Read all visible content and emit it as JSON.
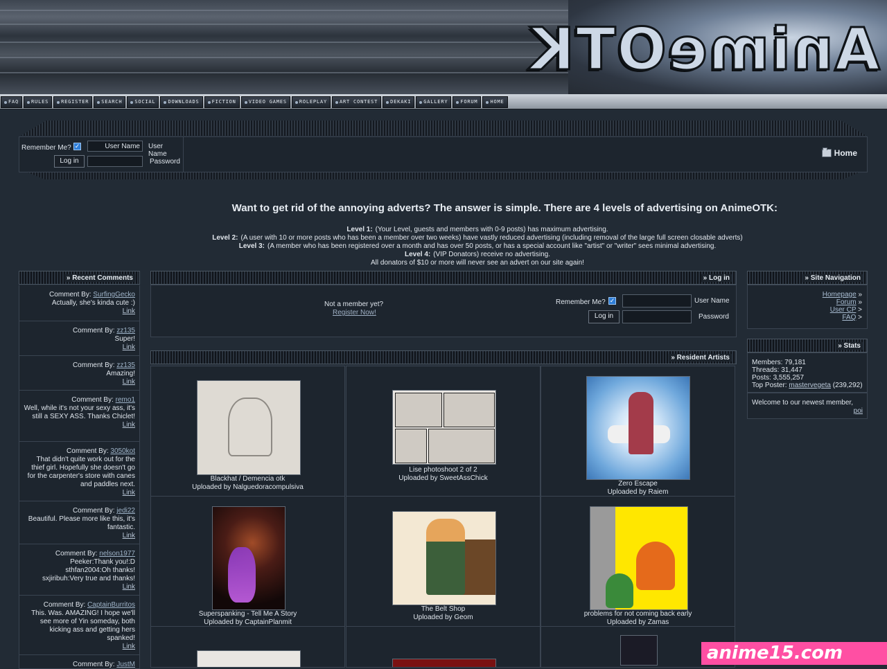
{
  "banner": {
    "logo_text": "AnimeOTK"
  },
  "nav": {
    "buttons": [
      "HOME",
      "FORUM",
      "GALLERY",
      "DEKAKI",
      "ART CONTEST",
      "ROLEPLAY",
      "VIDEO GAMES",
      "FICTION",
      "DOWNLOADS",
      "SOCIAL",
      "SEARCH",
      "REGISTER",
      "RULES",
      "FAQ"
    ]
  },
  "header": {
    "home_label": "Home",
    "login": {
      "username_label": "User Name",
      "username_value": "User Name",
      "password_label": "Password",
      "remember_label": "Remember Me?",
      "login_button": "Log in"
    }
  },
  "announcement": {
    "title": "Want to get rid of the annoying adverts? The answer is simple. There are 4 levels of advertising on AnimeOTK:",
    "levels": [
      {
        "label": "Level 1:",
        "text": "(Your Level, guests and members with 0-9 posts) has maximum advertising."
      },
      {
        "label": "Level 2:",
        "text": "(A user with 10 or more posts who has been a member over two weeks) have vastly reduced advertising (including removal of the large full screen closable adverts)"
      },
      {
        "label": "Level 3:",
        "text": "(A member who has been registered over a month and has over 50 posts, or has a special account like \"artist\" or \"writer\" sees minimal advertising."
      },
      {
        "label": "Level 4:",
        "text": "(VIP Donators) receive no advertising."
      }
    ],
    "footer": "All donators of $10 or more will never see an advert on our site again!"
  },
  "recent_comments": {
    "title": "» Recent Comments",
    "by_label": "Comment By:",
    "link_label": "Link",
    "items": [
      {
        "user": "SurfingGecko",
        "text": "Actually, she's kinda cute :)"
      },
      {
        "user": "zz135",
        "text": "Super!"
      },
      {
        "user": "zz135",
        "text": "Amazing!"
      },
      {
        "user": "remo1",
        "text": "Well, while it's not your sexy ass, it's still a SEXY ASS. Thanks Chiclet!"
      },
      {
        "user": "3050kot",
        "text": "That didn't quite work out for the thief girl. Hopefully she doesn't go for the carpenter's store with canes and paddles next."
      },
      {
        "user": "jedi22",
        "text": "Beautiful. Please more like this, it's fantastic."
      },
      {
        "user": "nelson1977",
        "text": "Peeker:Thank you!:D sthfan2004:Oh thanks! sxjiribuh:Very true and thanks!"
      },
      {
        "user": "CaptainBurritos",
        "text": "This. Was. AMAZING! I hope we'll see more of Yin someday, both kicking ass and getting hers spanked!"
      },
      {
        "user": "JustM",
        "text": ""
      }
    ]
  },
  "login_panel": {
    "title": "» Log in",
    "username_label": "User Name",
    "password_label": "Password",
    "remember_label": "Remember Me?",
    "login_button": "Log in",
    "not_member": "Not a member yet?",
    "register_link": "Register Now!"
  },
  "site_nav": {
    "title": "» Site Navigation",
    "links": [
      {
        "bullet": "»",
        "label": "Homepage"
      },
      {
        "bullet": "»",
        "label": "Forum"
      },
      {
        "bullet": ">",
        "label": "User CP"
      },
      {
        "bullet": ">",
        "label": "FAQ"
      }
    ]
  },
  "stats": {
    "title": "» Stats",
    "members": "Members: 79,181",
    "threads": "Threads: 31,447",
    "posts": "Posts: 3,555,257",
    "top_poster_label": "Top Poster:",
    "top_poster_name": "mastervegeta",
    "top_poster_count": "(239,292)",
    "welcome": "Welcome to our newest member,",
    "newest_member": "poi"
  },
  "artists": {
    "title": "» Resident Artists",
    "uploaded_by": "Uploaded by",
    "items": [
      {
        "title": "Zero Escape",
        "uploader": "Raiem"
      },
      {
        "title": "Lise photoshoot 2 of 2",
        "uploader": "SweetAssChick"
      },
      {
        "title": "Blackhat / Demencia otk",
        "uploader": "Nalguedoracompulsiva"
      },
      {
        "title": "problems for not coming back early",
        "uploader": "Zamas"
      },
      {
        "title": "The Belt Shop",
        "uploader": "Geom"
      },
      {
        "title": "Superspanking - Tell Me A Story",
        "uploader": "CaptainPlanmit"
      }
    ]
  },
  "watermark": {
    "text": "anime15.com"
  }
}
